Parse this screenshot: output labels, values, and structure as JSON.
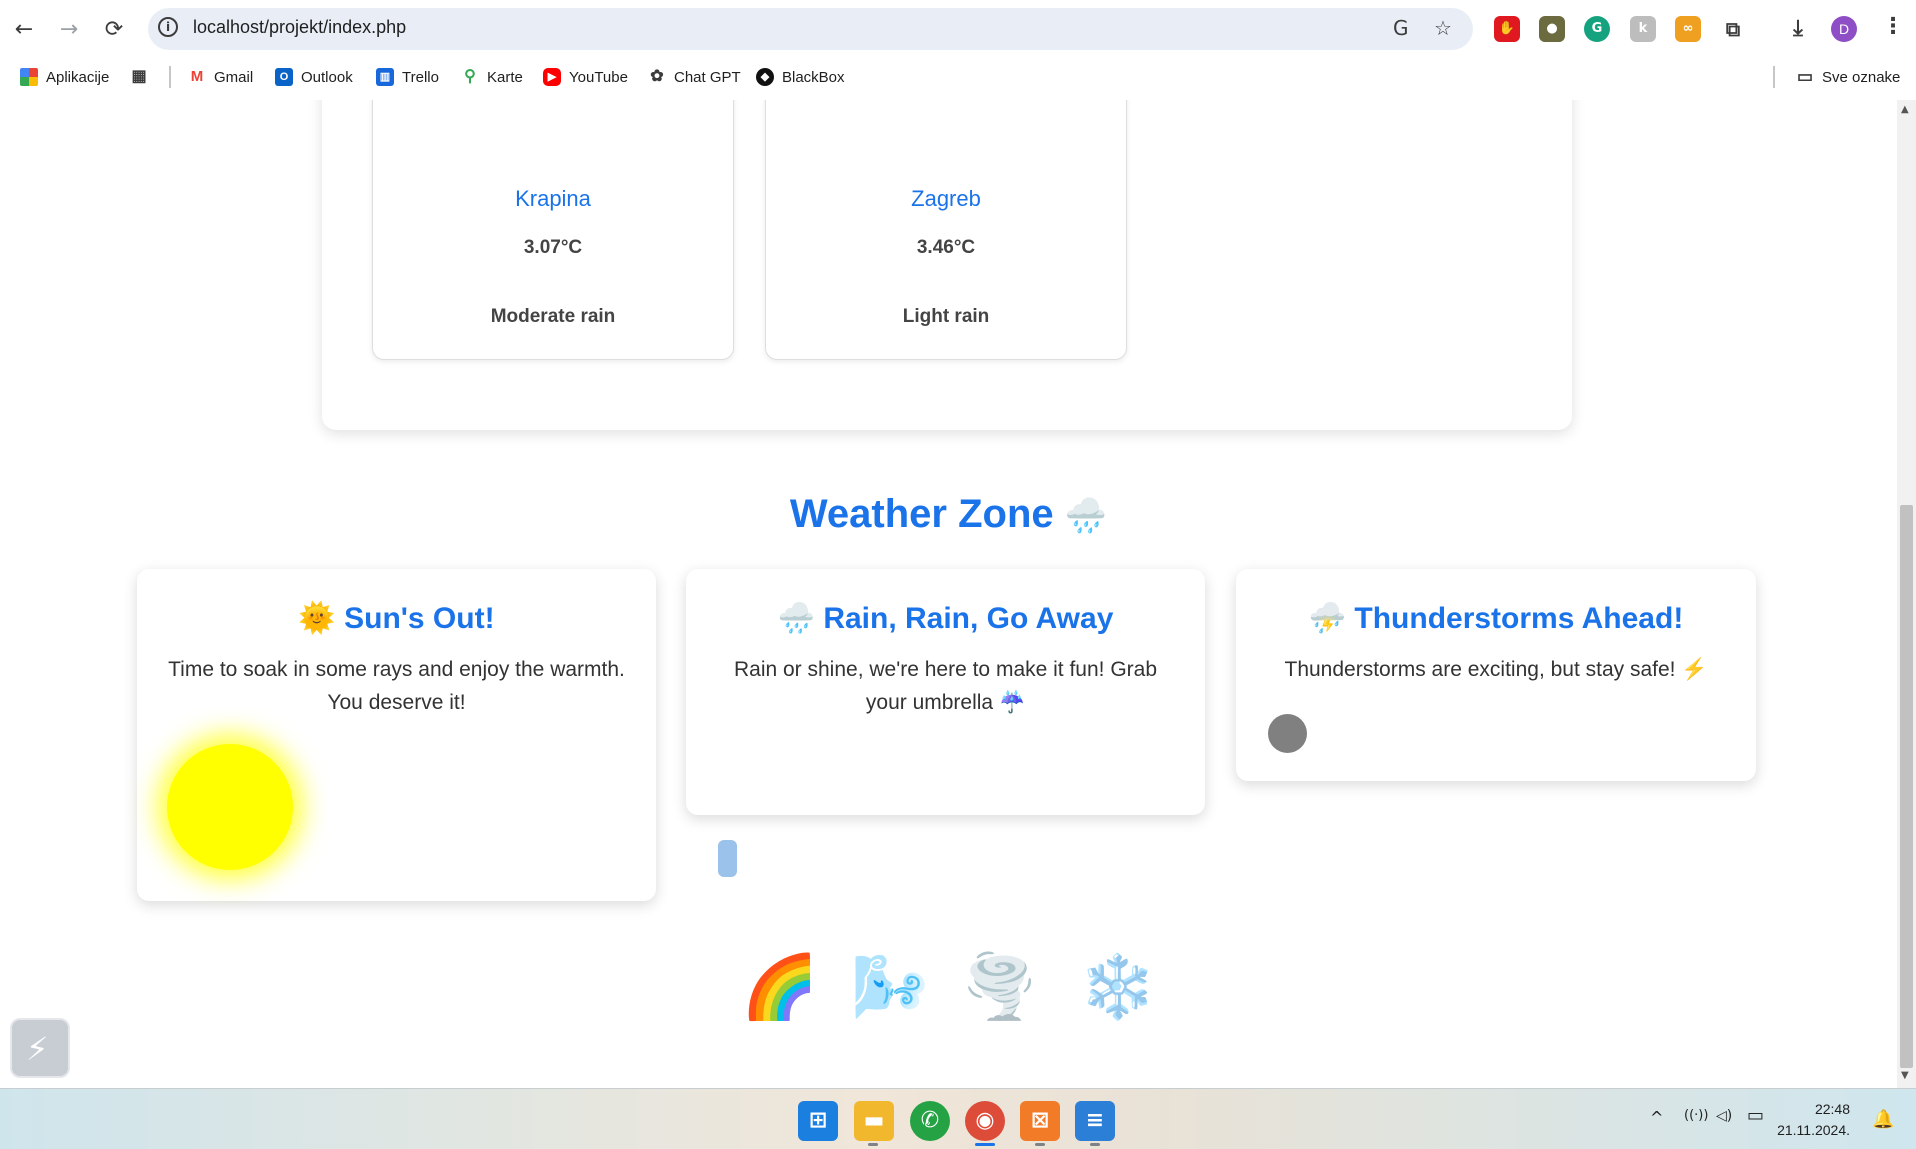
{
  "browser": {
    "url": "localhost/projekt/index.php",
    "back": "←",
    "forward": "→",
    "reload": "⟳",
    "info_glyph": "i",
    "translate_glyph": "G",
    "star_glyph": "☆",
    "avatar_letter": "D",
    "menu_glyph": "⋮",
    "extensions": [
      {
        "name": "opera-adblock-icon",
        "color": "#e0181f",
        "glyph": "✋"
      },
      {
        "name": "shield-extension-icon",
        "color": "#6b6b3f",
        "glyph": "●"
      },
      {
        "name": "grammarly-icon",
        "color": "#15a37f",
        "glyph": "G"
      },
      {
        "name": "extension-k-icon",
        "color": "#bdbdbd",
        "glyph": "k"
      },
      {
        "name": "extension-glasses-icon",
        "color": "#f0a020",
        "glyph": "∞"
      },
      {
        "name": "puzzle-extensions-icon",
        "color": "#ffffff",
        "glyph": "⧉"
      },
      {
        "name": "download-icon",
        "color": "#ffffff",
        "glyph": "⤓"
      }
    ]
  },
  "bookmarks": {
    "items": [
      {
        "label": "Aplikacije",
        "icon": "apps-grid-icon"
      },
      {
        "label": "",
        "icon": "grid-icon"
      },
      {
        "label": "Gmail",
        "icon": "gmail-icon"
      },
      {
        "label": "Outlook",
        "icon": "outlook-icon"
      },
      {
        "label": "Trello",
        "icon": "trello-icon"
      },
      {
        "label": "Karte",
        "icon": "maps-icon"
      },
      {
        "label": "YouTube",
        "icon": "youtube-icon"
      },
      {
        "label": "Chat GPT",
        "icon": "chatgpt-icon"
      },
      {
        "label": "BlackBox",
        "icon": "blackbox-icon"
      }
    ],
    "all_bookmarks": "Sve oznake"
  },
  "cities": [
    {
      "name": "Krapina",
      "temp": "3.07°C",
      "desc": "Moderate rain"
    },
    {
      "name": "Zagreb",
      "temp": "3.46°C",
      "desc": "Light rain"
    }
  ],
  "zone": {
    "title": "Weather Zone",
    "title_emoji": "🌧️",
    "cards": [
      {
        "emoji": "🌞",
        "title": "Sun's Out!",
        "text": "Time to soak in some rays and enjoy the warmth. You deserve it!"
      },
      {
        "emoji": "🌧️",
        "title": "Rain, Rain, Go Away",
        "text": "Rain or shine, we're here to make it fun! Grab your umbrella ☔"
      },
      {
        "emoji": "⛈️",
        "title": "Thunderstorms Ahead!",
        "text": "Thunderstorms are exciting, but stay safe! ⚡"
      }
    ],
    "bottom_icons": [
      {
        "emoji": "🌈",
        "name": "rainbow-icon"
      },
      {
        "emoji": "🌬️",
        "name": "wind-face-icon"
      },
      {
        "emoji": "🌪️",
        "name": "tornado-icon"
      },
      {
        "emoji": "❄️",
        "name": "snowflake-icon"
      }
    ]
  },
  "taskbar": {
    "time": "22:48",
    "date": "21.11.2024.",
    "apps": [
      {
        "name": "windows-start-icon",
        "glyph": "⊞",
        "color": "#1b7fe0"
      },
      {
        "name": "file-explorer-icon",
        "glyph": "▬",
        "color": "#f2b82d"
      },
      {
        "name": "whatsapp-icon",
        "glyph": "✆",
        "color": "#25a244"
      },
      {
        "name": "chrome-icon",
        "glyph": "◉",
        "color": "#dd4b39"
      },
      {
        "name": "xampp-icon",
        "glyph": "⊠",
        "color": "#f27b28"
      },
      {
        "name": "notepad-icon",
        "glyph": "≡",
        "color": "#2c7fd6"
      }
    ],
    "tray_chevron": "^",
    "wifi": "((·))",
    "volume": "◁)",
    "battery": "▭",
    "bell": "🔔"
  },
  "colors": {
    "accent": "#1a73e8",
    "sun": "#ffff00",
    "storm_ball": "#808080",
    "rain_drop": "#9bc2ea"
  }
}
